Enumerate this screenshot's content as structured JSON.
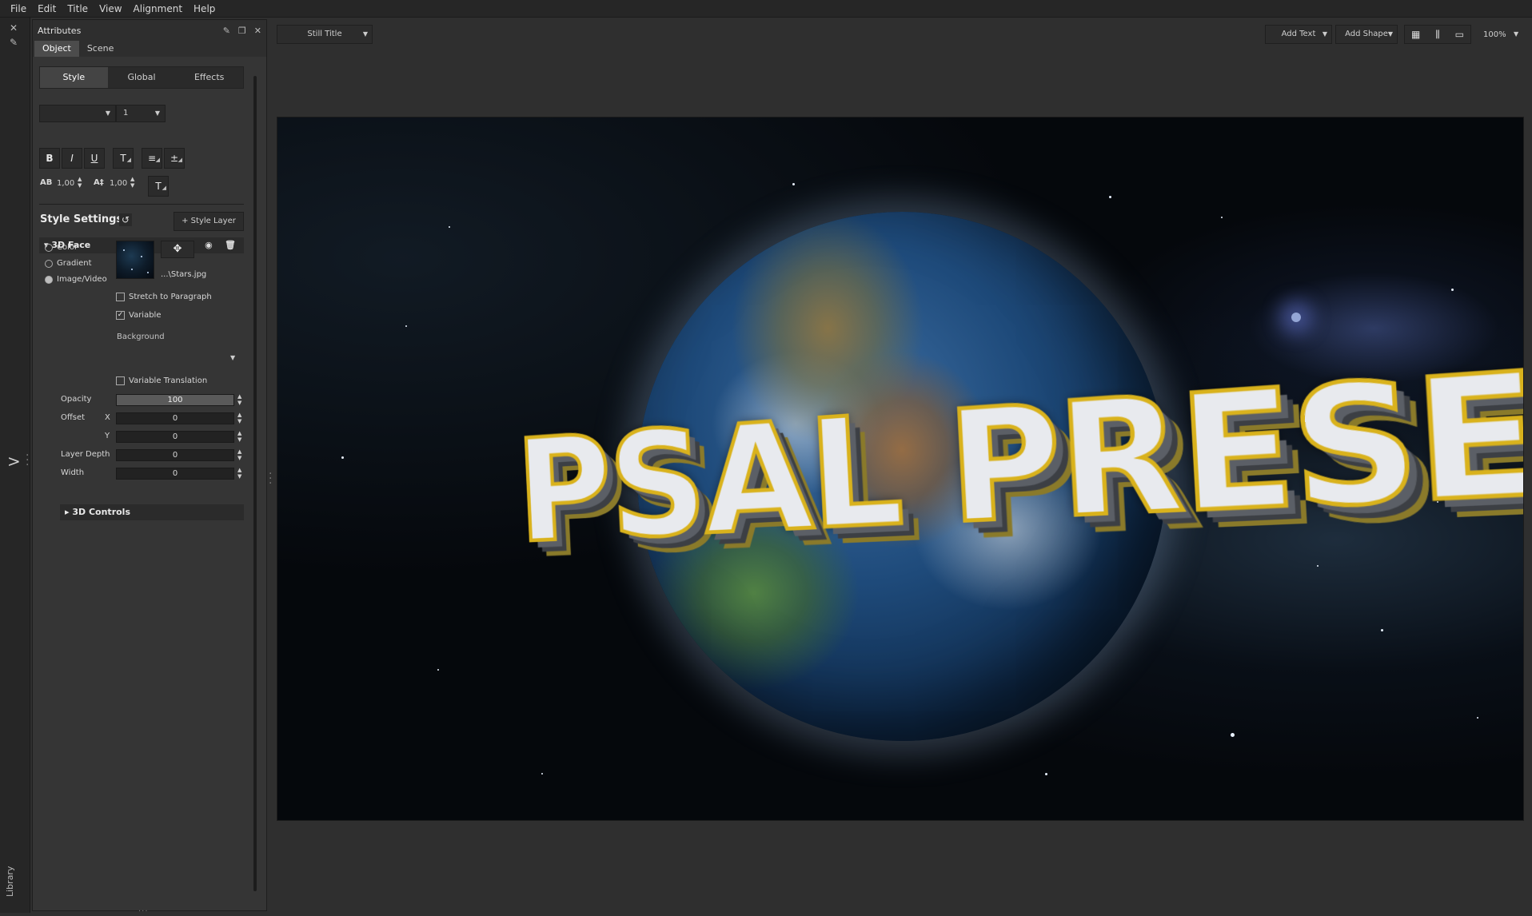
{
  "menu": [
    "File",
    "Edit",
    "Title",
    "View",
    "Alignment",
    "Help"
  ],
  "left_strip": {
    "library_label": "Library"
  },
  "attributes": {
    "title": "Attributes",
    "tabs": [
      "Object",
      "Scene"
    ],
    "subtabs": [
      "Style",
      "Global",
      "Effects"
    ],
    "font_size_value": "1",
    "kerning_value": "1,00",
    "leading_value": "1,00",
    "style_settings_title": "Style Settings",
    "style_layer_button": "+ Style Layer",
    "layer_name": "3D Face",
    "fill_options": [
      "Color",
      "Gradient",
      "Image/Video"
    ],
    "selected_fill": "Image/Video",
    "file_name": "...\\Stars.jpg",
    "stretch_label": "Stretch to Paragraph",
    "variable_label": "Variable",
    "background_label": "Background",
    "variable_translation_label": "Variable Translation",
    "props": {
      "opacity_label": "Opacity",
      "opacity_value": "100",
      "offset_label": "Offset",
      "x_label": "X",
      "x_value": "0",
      "y_label": "Y",
      "y_value": "0",
      "layer_depth_label": "Layer Depth",
      "layer_depth_value": "0",
      "width_label": "Width",
      "width_value": "0"
    },
    "controls_label": "3D Controls"
  },
  "toolbar": {
    "title_type": "Still Title",
    "add_text": "Add Text",
    "add_shape": "Add Shape",
    "zoom": "100%"
  },
  "preview": {
    "title_text": "PSAL PRESE"
  },
  "colors": {
    "panel_bg": "#353535",
    "app_bg": "#2f2f2f",
    "title_fill": "#e8eaee",
    "title_stroke": "#d9b21c"
  }
}
